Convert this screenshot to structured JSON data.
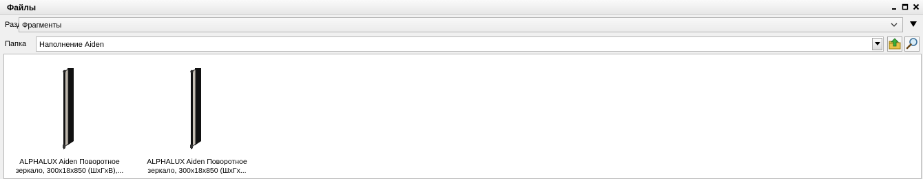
{
  "window": {
    "title": "Файлы"
  },
  "icons": {
    "minimize": "minimize-icon",
    "maximize": "maximize-icon",
    "close": "close-icon",
    "chevron": "chevron-down-icon",
    "menu": "triangle-down-icon",
    "folder_up": "folder-up-icon",
    "search": "magnifier-icon"
  },
  "section": {
    "label": "Раздел",
    "value": "Фрагменты"
  },
  "folder": {
    "label": "Папка",
    "value": "Наполнение Aiden"
  },
  "files": [
    {
      "caption": "ALPHALUX Aiden Поворотное\nзеркало, 300х18х850 (ШхГхВ),..."
    },
    {
      "caption": "ALPHALUX Aiden Поворотное\nзеркало, 300х18х850 (ШхГх..."
    }
  ]
}
